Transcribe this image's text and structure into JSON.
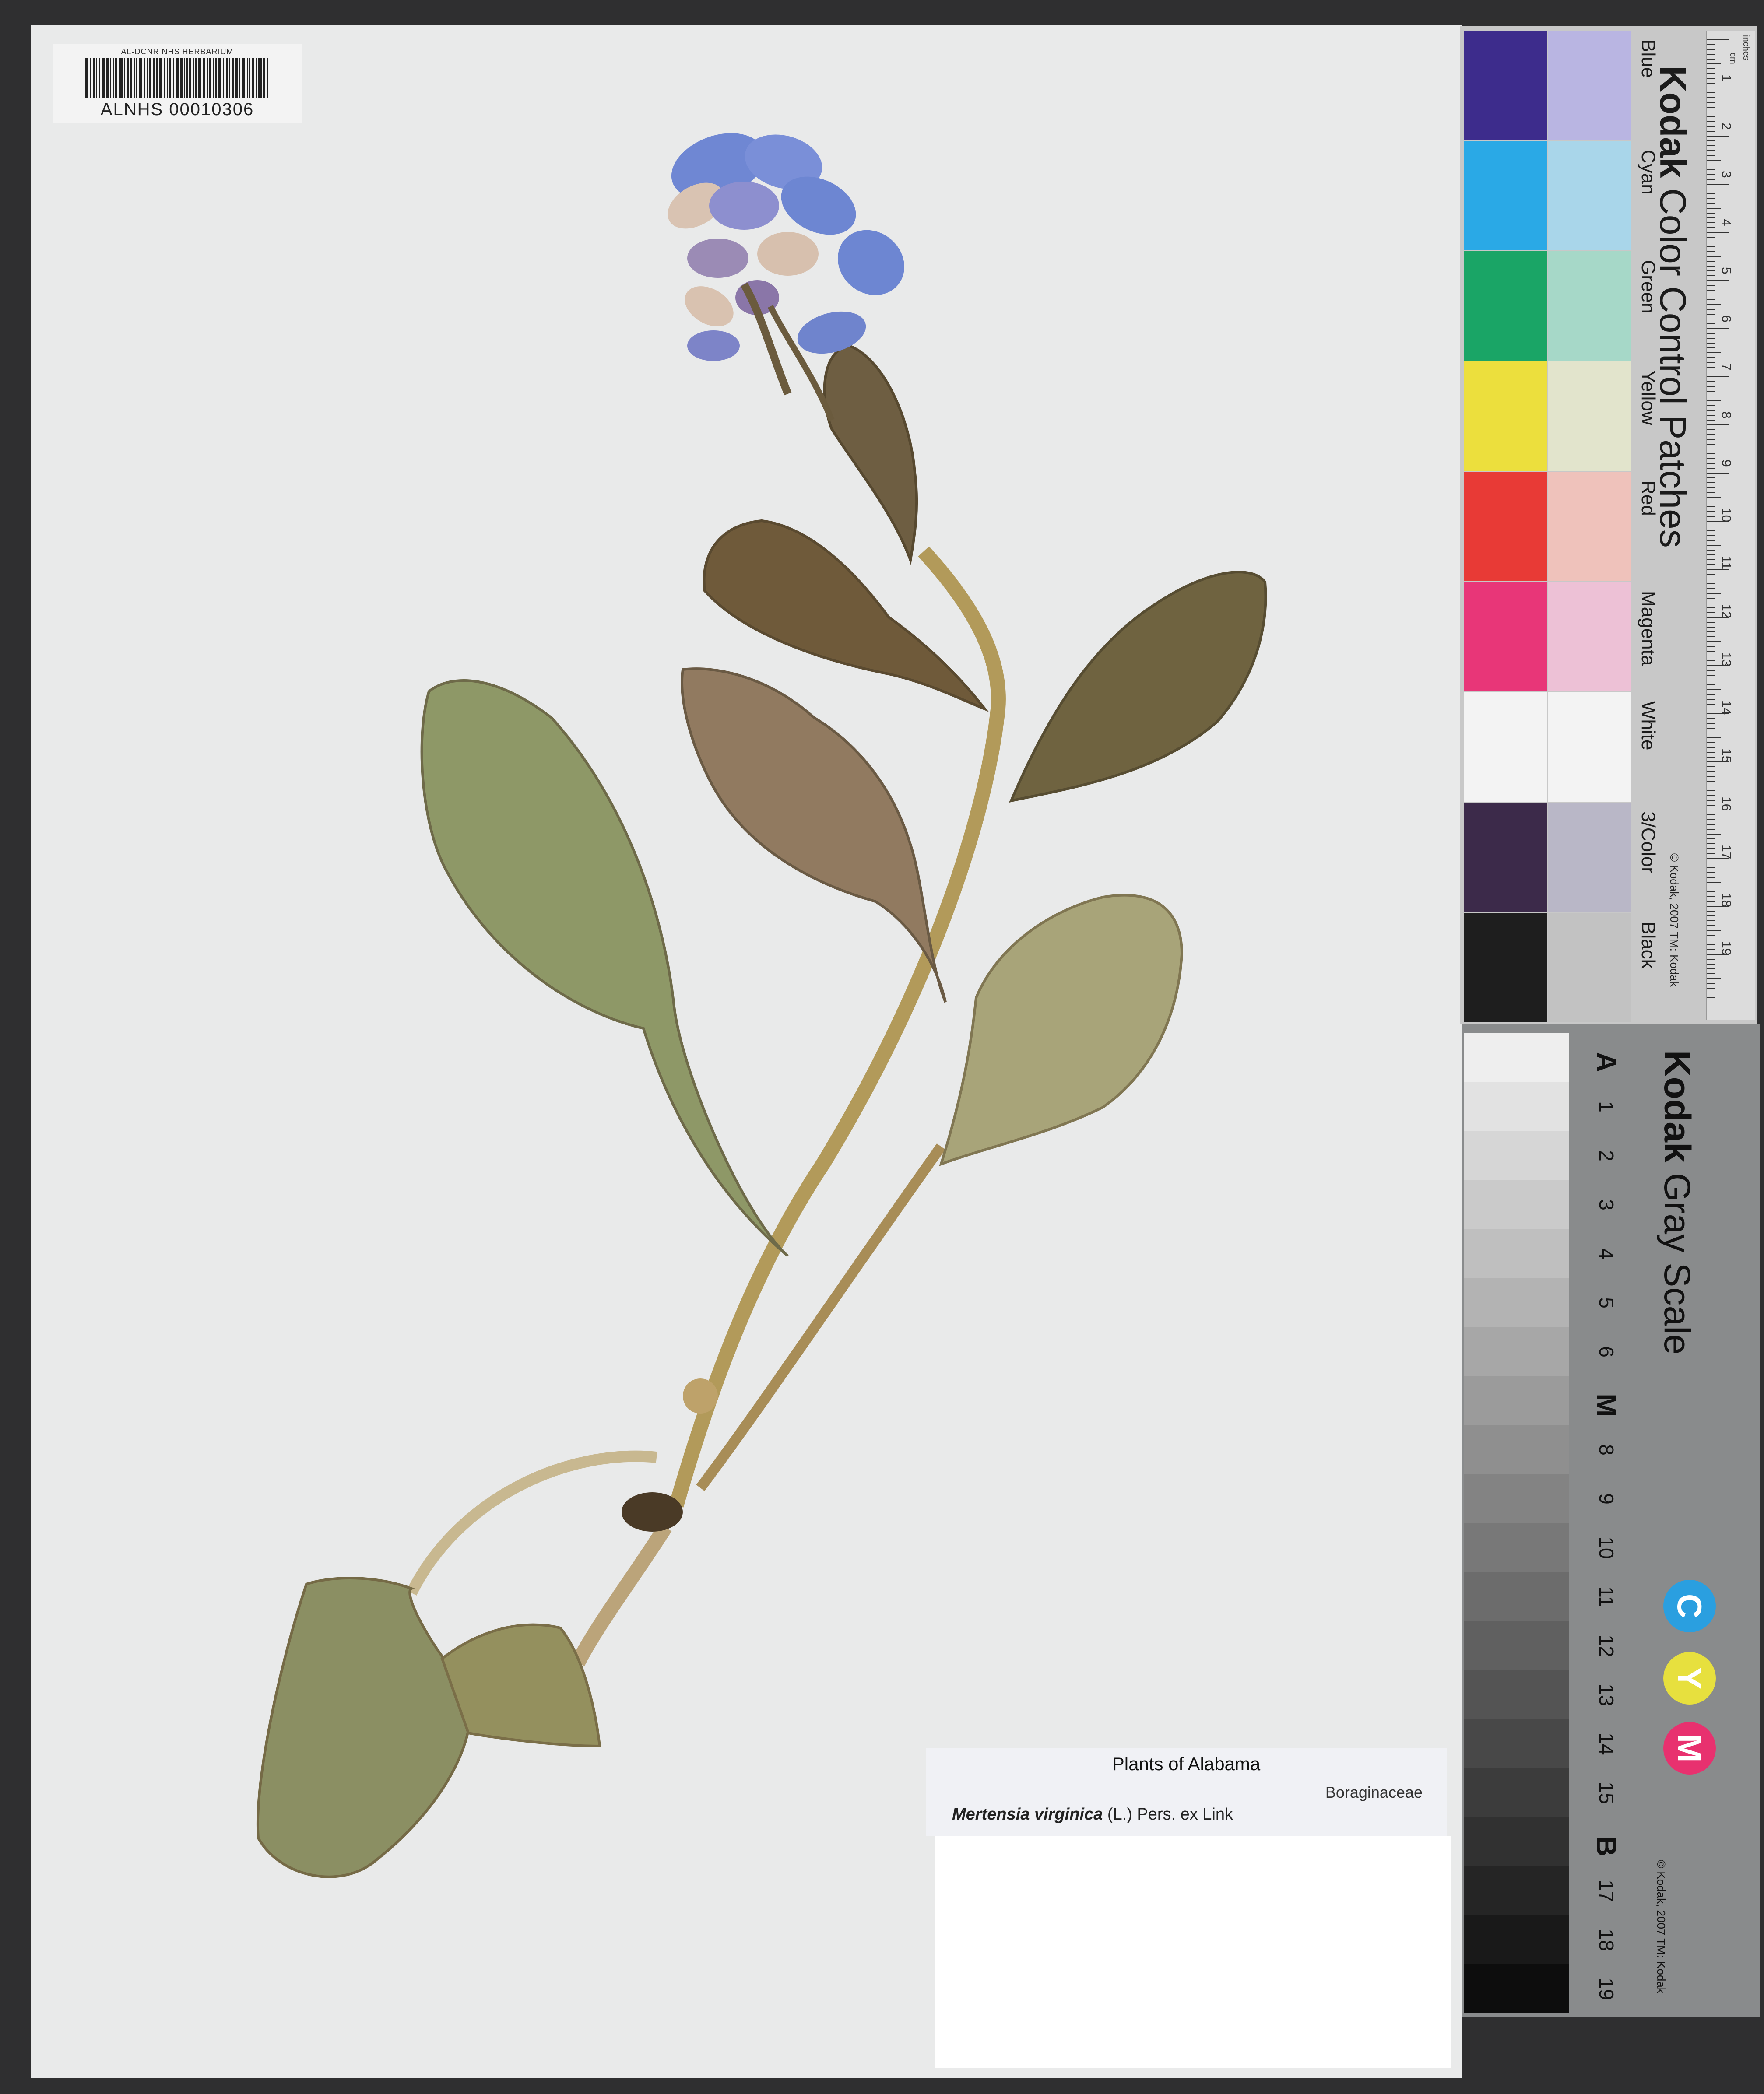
{
  "barcode": {
    "top_text": "AL-DCNR NHS HERBARIUM",
    "number": "ALNHS 00010306"
  },
  "color_card": {
    "brand": "Kodak",
    "title": "Color Control Patches",
    "patches": [
      {
        "label": "Blue",
        "dark": "#3d2c8c",
        "light": "#b9b5e2"
      },
      {
        "label": "Cyan",
        "dark": "#2aa9e6",
        "light": "#a9d6ea"
      },
      {
        "label": "Green",
        "dark": "#1aa566",
        "light": "#a6d8c8"
      },
      {
        "label": "Yellow",
        "dark": "#ecdf3d",
        "light": "#e2e4cc"
      },
      {
        "label": "Red",
        "dark": "#e83a36",
        "light": "#efc2bb"
      },
      {
        "label": "Magenta",
        "dark": "#e83678",
        "light": "#edc1d6"
      },
      {
        "label": "White",
        "dark": "#f3f3f3",
        "light": "#f3f3f3"
      },
      {
        "label": "3/Color",
        "dark": "#3c2a4a",
        "light": "#b9b7c7"
      },
      {
        "label": "Black",
        "dark": "#1e1e1e",
        "light": "#c2c2c2"
      }
    ],
    "copyright": "© Kodak, 2007 TM: Kodak",
    "ruler_units": [
      "inches",
      "cm"
    ],
    "ruler_numbers": [
      "1",
      "2",
      "3",
      "4",
      "5",
      "6",
      "7",
      "8",
      "9",
      "10",
      "11",
      "12",
      "13",
      "14",
      "15",
      "16",
      "17",
      "18",
      "19"
    ]
  },
  "gray_card": {
    "brand": "Kodak",
    "title": "Gray Scale",
    "steps": [
      "A",
      "1",
      "2",
      "3",
      "4",
      "5",
      "6",
      "M",
      "8",
      "9",
      "10",
      "11",
      "12",
      "13",
      "14",
      "15",
      "B",
      "17",
      "18",
      "19"
    ],
    "cym": [
      {
        "letter": "C",
        "color": "#2a9fe0"
      },
      {
        "letter": "Y",
        "color": "#e7e03e"
      },
      {
        "letter": "M",
        "color": "#e8316f"
      }
    ],
    "copyright": "© Kodak, 2007 TM: Kodak"
  },
  "label": {
    "title": "Plants of Alabama",
    "family": "Boraginaceae",
    "genus_species": "Mertensia virginica",
    "authority": "(L.) Pers. ex Link"
  },
  "colors": {
    "sheet": "#e9eaea",
    "leaf": "#8a8a5c",
    "leaf_dark": "#6d563a",
    "stem": "#b49a57",
    "flower_blue": "#6d86d2",
    "flower_pink": "#d9bfb2"
  }
}
